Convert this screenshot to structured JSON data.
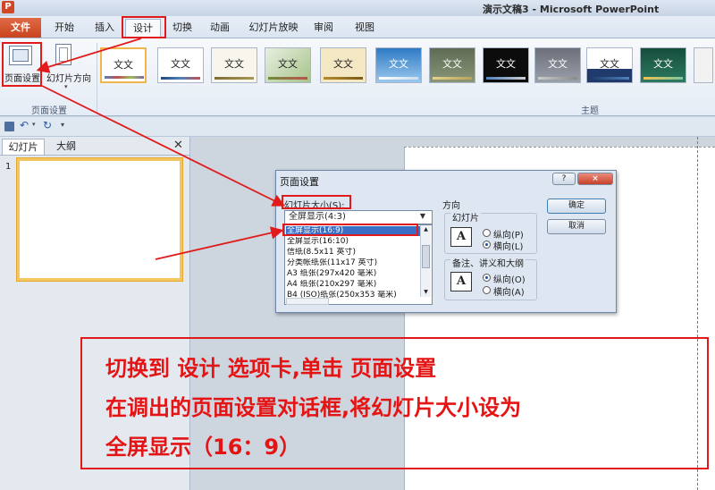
{
  "window": {
    "title": "演示文稿3 - Microsoft PowerPoint",
    "app_icon": "P"
  },
  "tabs": {
    "file": "文件",
    "items": [
      "开始",
      "插入",
      "设计",
      "切换",
      "动画",
      "幻灯片放映",
      "审阅",
      "视图"
    ],
    "active": "设计"
  },
  "ribbon": {
    "page_setup_label": "页面设置",
    "orientation_label": "幻灯片方向",
    "group_page_setup": "页面设置",
    "group_themes": "主题",
    "theme_sample": "文文"
  },
  "left_pane": {
    "tab_slides": "幻灯片",
    "tab_outline": "大纲",
    "slide_number": "1"
  },
  "dialog": {
    "title": "页面设置",
    "size_label": "幻灯片大小(S):",
    "selected_size": "全屏显示(4:3)",
    "options": [
      "全屏显示(16:9)",
      "全屏显示(16:10)",
      "信纸(8.5x11 英寸)",
      "分类帐纸张(11x17 英寸)",
      "A3 纸张(297x420 毫米)",
      "A4 纸张(210x297 毫米)",
      "B4 (ISO)纸张(250x353 毫米)"
    ],
    "orientation_title": "方向",
    "slides_group": "幻灯片",
    "portrait": "纵向(P)",
    "landscape": "横向(L)",
    "notes_group": "备注、讲义和大纲",
    "portrait_notes": "纵向(O)",
    "landscape_notes": "横向(A)",
    "ok": "确定",
    "cancel": "取消",
    "help": "?",
    "close": "×"
  },
  "instructions": [
    "切换到 设计 选项卡,单击 页面设置",
    "在调出的页面设置对话框,将幻灯片大小设为",
    "全屏显示（16：9）"
  ],
  "colors": {
    "annotation_red": "#e11b1b",
    "ribbon_bg": "#e5ecf5",
    "file_tab": "#c8441f"
  }
}
